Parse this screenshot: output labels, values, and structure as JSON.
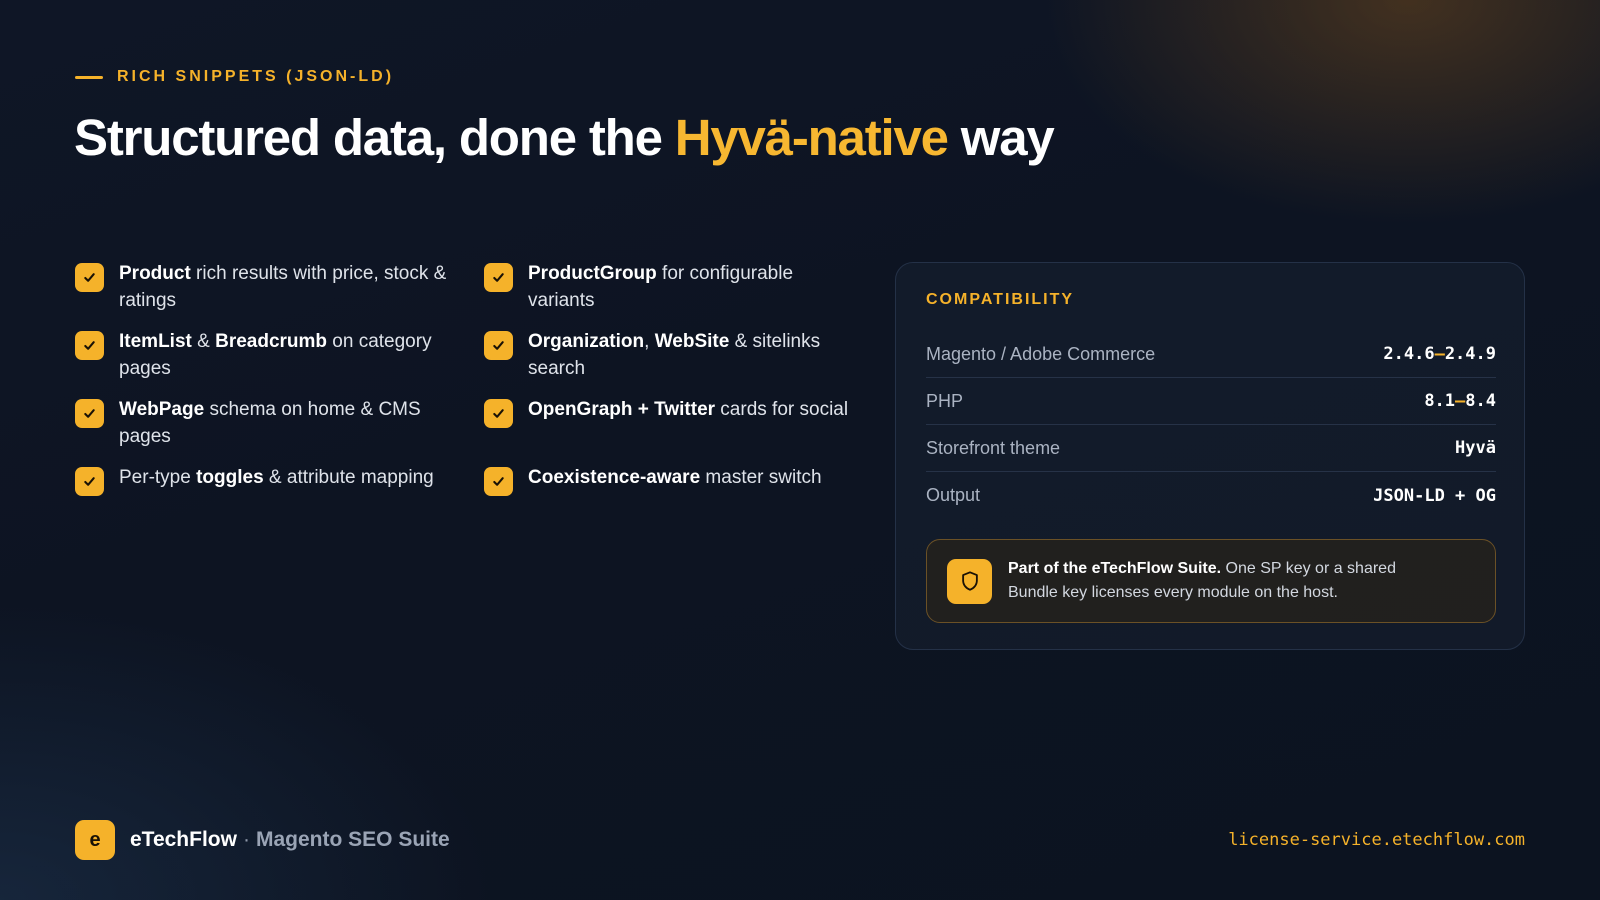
{
  "header": {
    "eyebrow": "RICH SNIPPETS (JSON-LD)",
    "title_pre": "Structured data, done the ",
    "title_accent": "Hyvä-native",
    "title_post": " way"
  },
  "features_left": [
    {
      "bold1": "Product",
      "text1": " rich results with price, stock & ratings"
    },
    {
      "bold1": "ItemList",
      "text1": " & ",
      "bold2": "Breadcrumb",
      "text2": " on category pages"
    },
    {
      "bold1": "WebPage",
      "text1": " schema on home & CMS pages"
    },
    {
      "text0": "Per-type ",
      "bold1": "toggles",
      "text1": " & attribute mapping"
    }
  ],
  "features_right": [
    {
      "bold1": "ProductGroup",
      "text1": " for configurable variants"
    },
    {
      "bold1": "Organization",
      "text1": ", ",
      "bold2": "WebSite",
      "text2": " & sitelinks search"
    },
    {
      "bold1": "OpenGraph + Twitter",
      "text1": " cards for social"
    },
    {
      "bold1": "Coexistence-aware",
      "text1": " master switch"
    }
  ],
  "compatibility": {
    "title": "COMPATIBILITY",
    "rows": [
      {
        "key": "Magento / Adobe Commerce",
        "v1": "2.4.6",
        "dash": "–",
        "v2": "2.4.9"
      },
      {
        "key": "PHP",
        "v1": "8.1",
        "dash": "–",
        "v2": "8.4"
      },
      {
        "key": "Storefront theme",
        "v1": "Hyvä"
      },
      {
        "key": "Output",
        "v1": "JSON-LD + OG"
      }
    ],
    "suite_bold": "Part of the eTechFlow Suite.",
    "suite_text": " One SP key or a shared Bundle key licenses every module on the host."
  },
  "footer": {
    "logo_letter": "e",
    "brand": "eTechFlow",
    "separator": "·",
    "product": "Magento SEO Suite",
    "url": "license-service.etechflow.com"
  },
  "colors": {
    "accent": "#f5b22a",
    "background": "#0e1524"
  },
  "icons": {
    "check": "check-icon",
    "shield": "shield-icon"
  }
}
